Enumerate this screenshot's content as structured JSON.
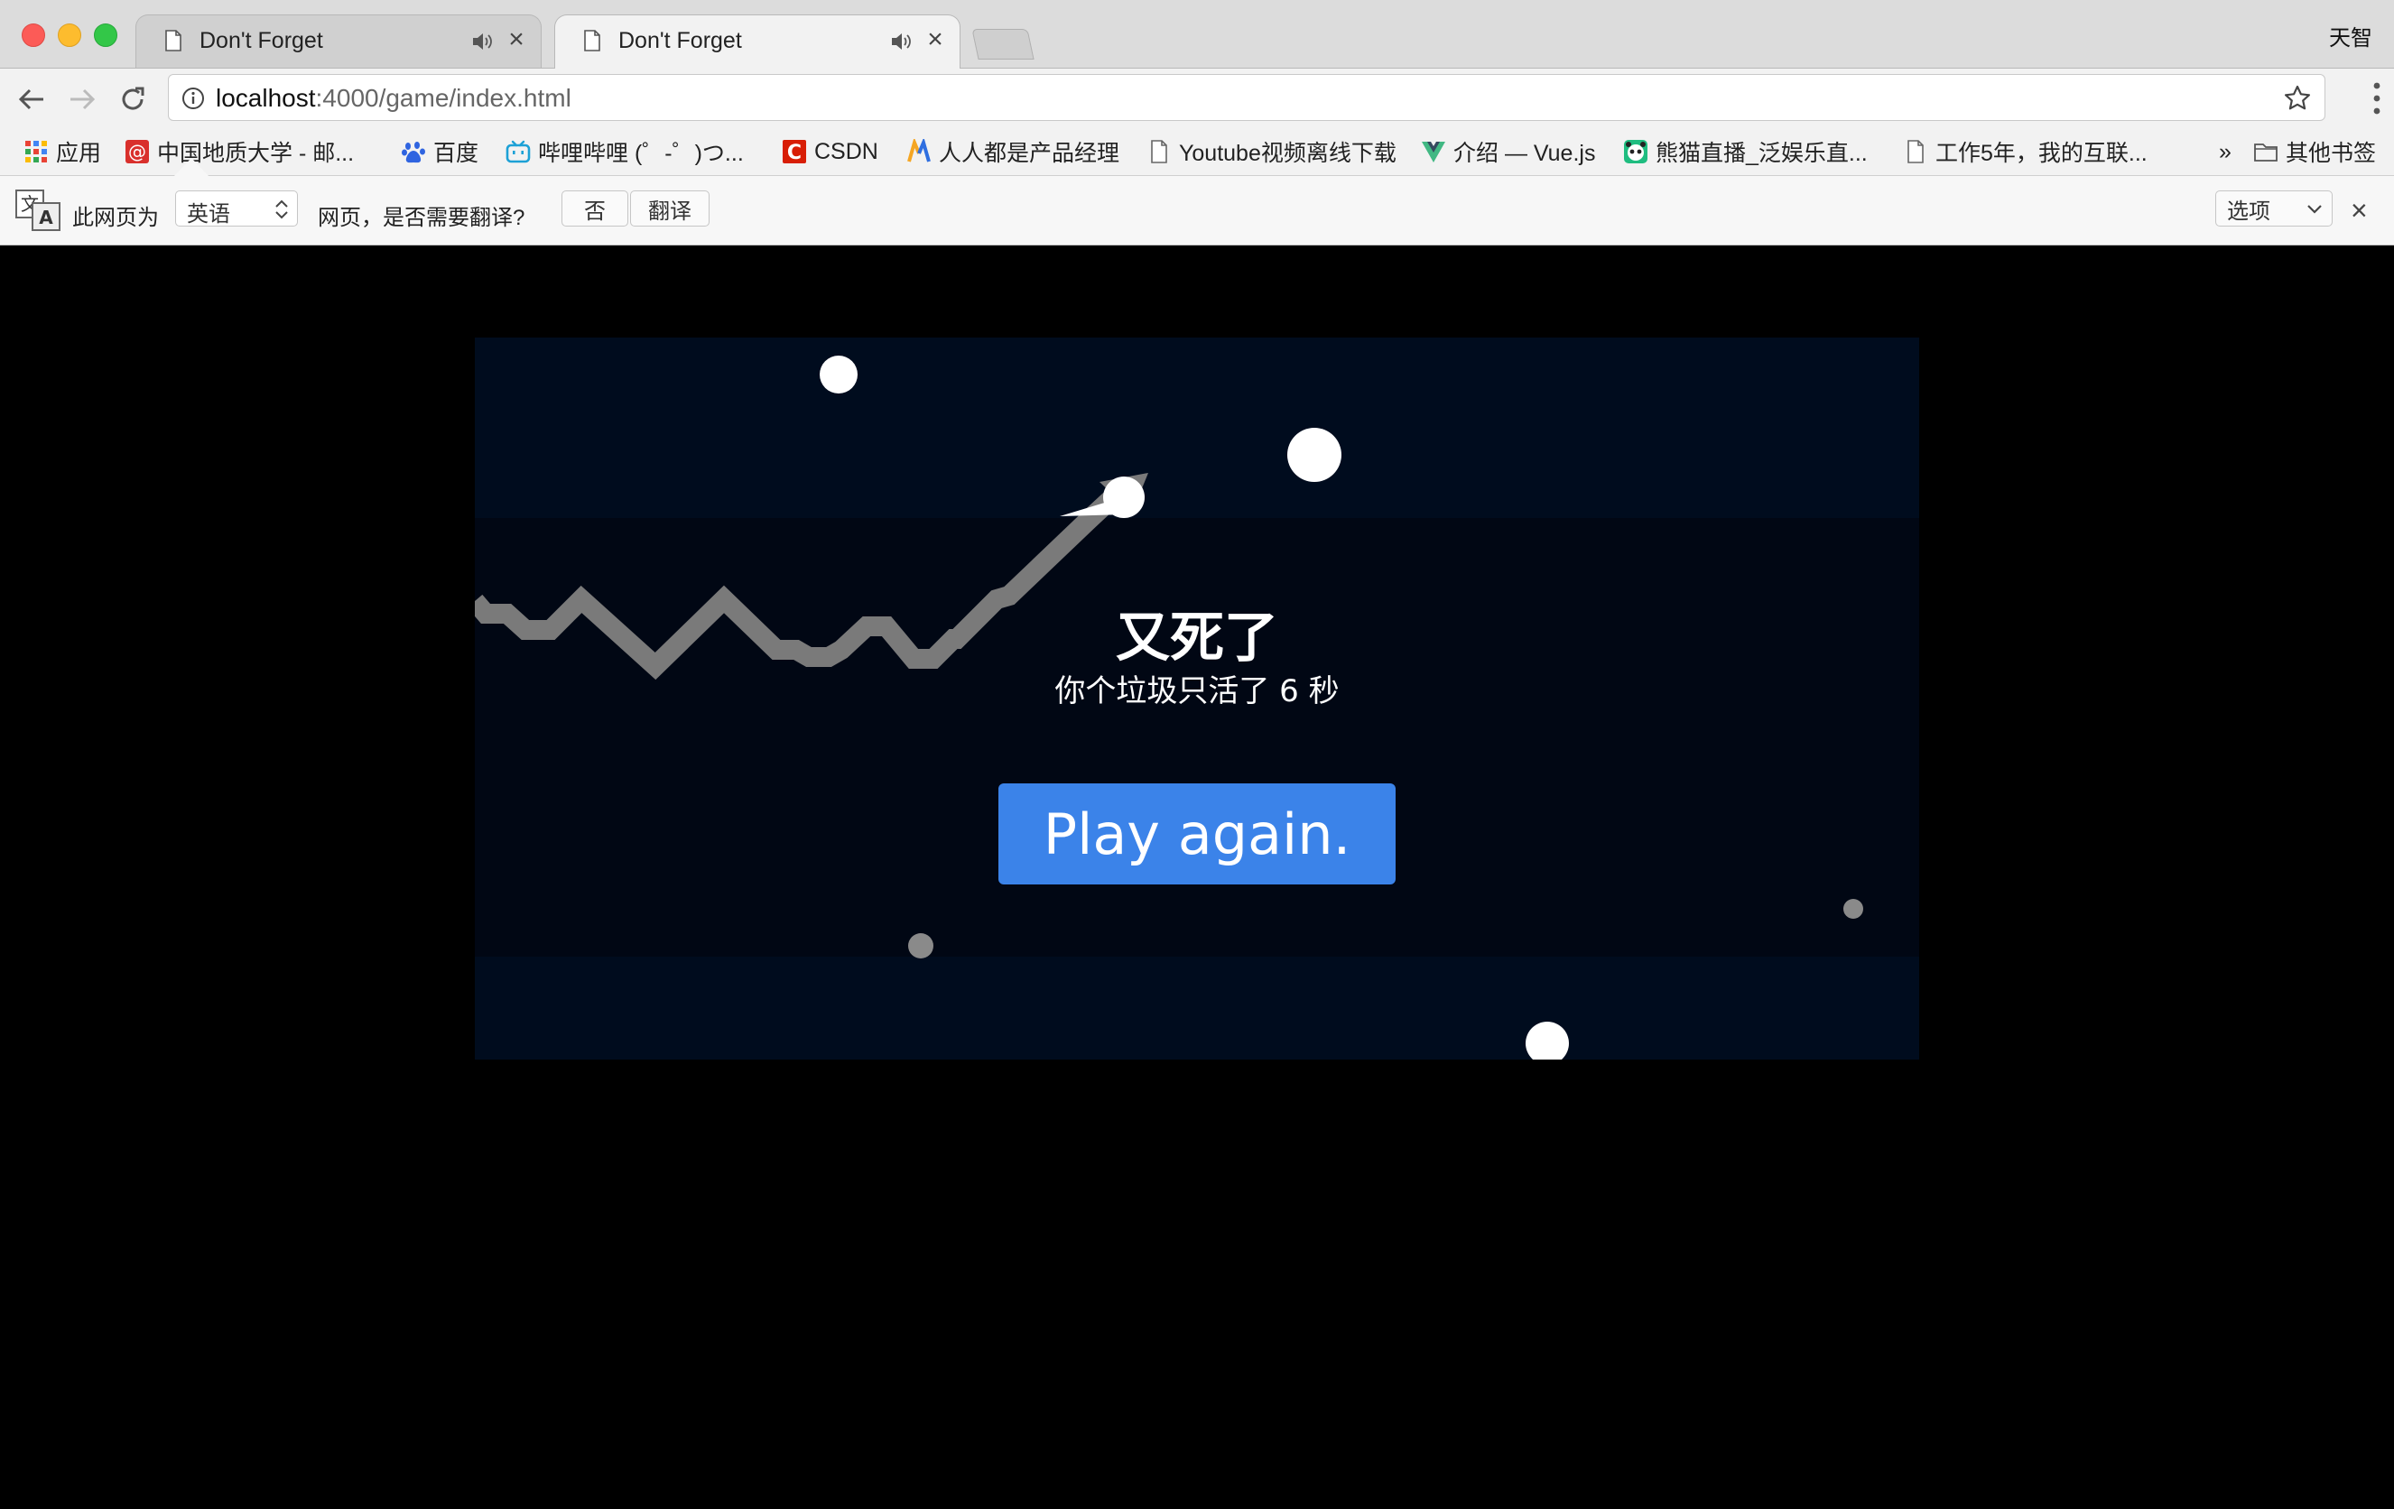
{
  "window": {
    "profile_name": "天智",
    "tabs": [
      {
        "title": "Don't Forget",
        "active": false
      },
      {
        "title": "Don't Forget",
        "active": true
      }
    ]
  },
  "toolbar": {
    "url_host": "localhost",
    "url_path": ":4000/game/index.html"
  },
  "bookmarks": {
    "items": [
      {
        "label": "应用",
        "icon": "apps-grid-icon"
      },
      {
        "label": "中国地质大学 - 邮...",
        "icon": "mail-at-icon"
      },
      {
        "label": "百度",
        "icon": "baidu-paw-icon"
      },
      {
        "label": "哔哩哔哩 (゜-゜)つ...",
        "icon": "bilibili-icon"
      },
      {
        "label": "CSDN",
        "icon": "csdn-icon"
      },
      {
        "label": "人人都是产品经理",
        "icon": "woshipm-icon"
      },
      {
        "label": "Youtube视频离线下载",
        "icon": "page-icon"
      },
      {
        "label": "介绍 — Vue.js",
        "icon": "vue-icon"
      },
      {
        "label": "熊猫直播_泛娱乐直...",
        "icon": "panda-icon"
      },
      {
        "label": "工作5年，我的互联...",
        "icon": "page-icon"
      }
    ],
    "overflow": "»",
    "other_folder": "其他书签"
  },
  "translate_bar": {
    "prefix": "此网页为",
    "language": "英语",
    "question": "网页，是否需要翻译?",
    "no_button": "否",
    "translate_button": "翻译",
    "options": "选项",
    "close": "×"
  },
  "game": {
    "title": "又死了",
    "subtitle": "你个垃圾只活了 6 秒",
    "play_again": "Play again."
  },
  "colors": {
    "game_bg": "#000c1e",
    "game_mid_band": "#010714",
    "button_blue": "#3b83e9",
    "trail_gray": "#7a7a7a"
  }
}
